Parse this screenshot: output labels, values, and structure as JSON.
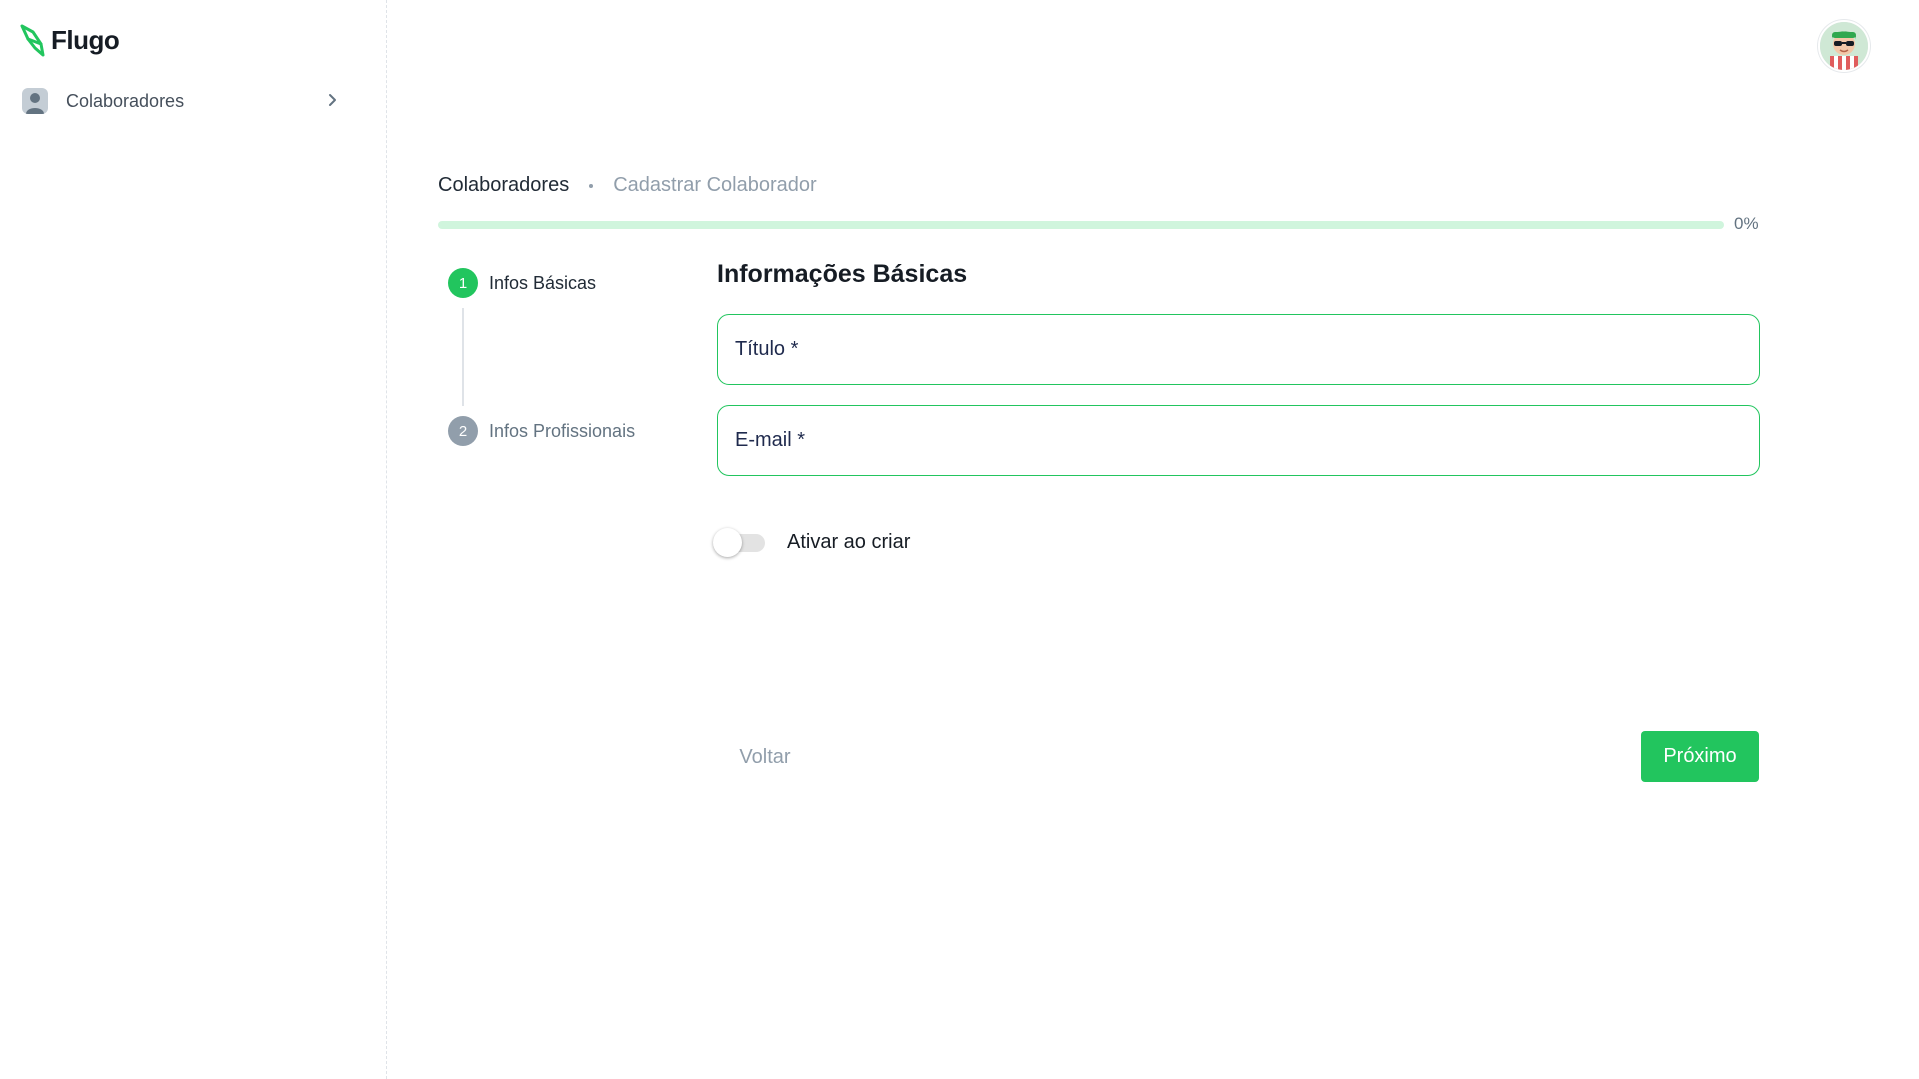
{
  "app": {
    "name": "Flugo"
  },
  "sidebar": {
    "items": [
      {
        "label": "Colaboradores",
        "icon": "user-icon"
      }
    ]
  },
  "breadcrumb": [
    "Colaboradores",
    "Cadastrar Colaborador"
  ],
  "progress": {
    "percent": 0,
    "label": "0%"
  },
  "steps": [
    {
      "number": "1",
      "label": "Infos Básicas",
      "status": "active"
    },
    {
      "number": "2",
      "label": "Infos Profissionais",
      "status": "pending"
    }
  ],
  "form": {
    "title": "Informações Básicas",
    "fields": {
      "title": {
        "label": "Título *",
        "value": ""
      },
      "email": {
        "label": "E-mail *",
        "value": ""
      }
    },
    "activate_toggle": {
      "label": "Ativar ao criar",
      "checked": false
    }
  },
  "actions": {
    "back": "Voltar",
    "next": "Próximo"
  },
  "colors": {
    "accent": "#22c55e",
    "accent_light": "#d0f5dd",
    "muted": "#919eab"
  }
}
